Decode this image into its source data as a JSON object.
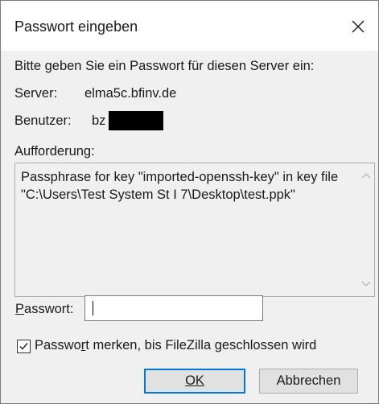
{
  "dialog": {
    "title": "Passwort eingeben",
    "instruction": "Bitte geben Sie ein Passwort für diesen Server ein:",
    "server_label": "Server:",
    "server_value": "elma5c.bfinv.de",
    "user_label": "Benutzer:",
    "user_value": "bz",
    "prompt_label": "Aufforderung:",
    "prompt_text": "Passphrase for key \"imported-openssh-key\" in key file \"C:\\Users\\Test System St I 7\\Desktop\\test.ppk\"",
    "password_label_ul": "P",
    "password_label_rest": "asswort:",
    "password_value": "",
    "remember_checked": true,
    "remember_label_pre": "Passwo",
    "remember_label_ul": "r",
    "remember_label_post": "t merken, bis FileZilla geschlossen wird",
    "ok_label": "OK",
    "cancel_label": "Abbrechen"
  },
  "icons": {
    "close": "close-icon",
    "scroll_up": "chevron-up-icon",
    "scroll_down": "chevron-down-icon",
    "check": "checkmark-icon"
  },
  "colors": {
    "dialog_bg": "#f0f0f0",
    "titlebar_bg": "#ffffff",
    "default_button_border": "#0078d7",
    "button_bg": "#e1e1e1"
  }
}
